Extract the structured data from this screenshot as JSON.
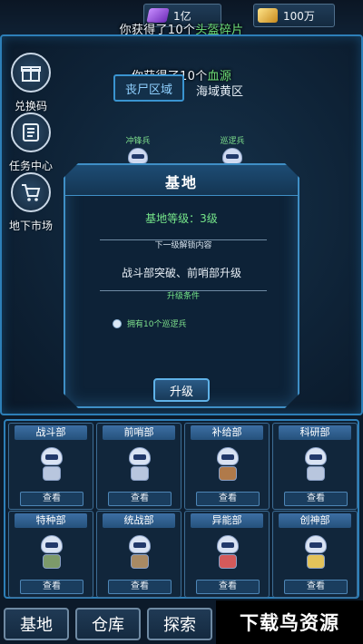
{
  "resources": {
    "diamond": "1亿",
    "gold": "100万"
  },
  "toasts": {
    "top": {
      "prefix": "你获得了10个",
      "item": "头盔碎片"
    },
    "mid": {
      "prefix": "你获得了10个",
      "item": "血源"
    }
  },
  "sidebar": [
    {
      "label": "兑换码",
      "icon": "gift-box-icon"
    },
    {
      "label": "任务中心",
      "icon": "task-list-icon"
    },
    {
      "label": "地下市场",
      "icon": "shopping-cart-icon"
    }
  ],
  "areas": {
    "active": "丧尸区域",
    "other": "海域黄区"
  },
  "characters": [
    {
      "name": "冲锋兵"
    },
    {
      "name": "巡逻兵"
    }
  ],
  "dialog": {
    "title": "基地",
    "level": "基地等级：3级",
    "next_unlock_label": "下一级解锁内容",
    "unlock_content": "战斗部突破、前哨部升级",
    "condition_label": "升级条件",
    "condition": "拥有10个巡逻兵",
    "upgrade_button": "升级"
  },
  "departments": [
    {
      "name": "战斗部",
      "action": "查看"
    },
    {
      "name": "前哨部",
      "action": "查看"
    },
    {
      "name": "补给部",
      "action": "查看"
    },
    {
      "name": "科研部",
      "action": "查看"
    },
    {
      "name": "特种部",
      "action": "查看"
    },
    {
      "name": "统战部",
      "action": "查看"
    },
    {
      "name": "异能部",
      "action": "查看"
    },
    {
      "name": "创神部",
      "action": "查看"
    }
  ],
  "nav": [
    {
      "label": "基地"
    },
    {
      "label": "仓库"
    },
    {
      "label": "探索"
    }
  ],
  "watermark": "下载鸟资源",
  "colors": {
    "accent": "#2d7fb8",
    "highlight_green": "#6ee07a",
    "background": "#0c1a2a"
  }
}
